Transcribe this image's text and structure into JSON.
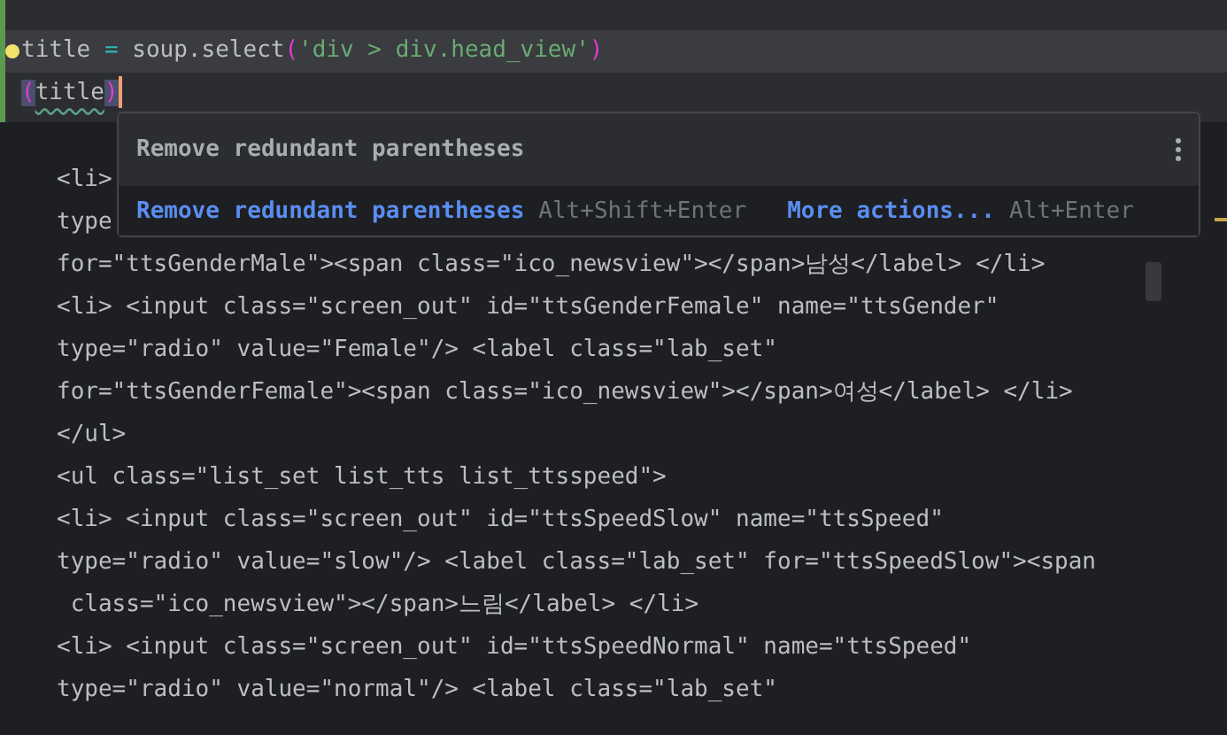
{
  "editor": {
    "block_lines": [
      {
        "highlighted": true,
        "tokens": [
          {
            "kind": "ident",
            "text": "title"
          },
          {
            "kind": "operator",
            "text": " = "
          },
          {
            "kind": "plain",
            "text": "soup.select"
          },
          {
            "kind": "paren",
            "text": "("
          },
          {
            "kind": "string",
            "text": "'div > div.head_view'"
          },
          {
            "kind": "paren",
            "text": ")"
          }
        ]
      },
      {
        "highlighted": false,
        "tokens": [
          {
            "kind": "paren_match",
            "text": "("
          },
          {
            "kind": "warning",
            "text": "title"
          },
          {
            "kind": "paren_match",
            "text": ")"
          }
        ]
      }
    ],
    "lines": [
      "<li>",
      "type",
      "for=\"ttsGenderMale\"><span class=\"ico_newsview\"></span>남성</label> </li>",
      "<li> <input class=\"screen_out\" id=\"ttsGenderFemale\" name=\"ttsGender\"",
      "type=\"radio\" value=\"Female\"/> <label class=\"lab_set\"",
      "for=\"ttsGenderFemale\"><span class=\"ico_newsview\"></span>여성</label> </li>",
      "</ul>",
      "<ul class=\"list_set list_tts list_ttsspeed\">",
      "<li> <input class=\"screen_out\" id=\"ttsSpeedSlow\" name=\"ttsSpeed\"",
      "type=\"radio\" value=\"slow\"/> <label class=\"lab_set\" for=\"ttsSpeedSlow\"><span",
      " class=\"ico_newsview\"></span>느림</label> </li>",
      "<li> <input class=\"screen_out\" id=\"ttsSpeedNormal\" name=\"ttsSpeed\"",
      "type=\"radio\" value=\"normal\"/> <label class=\"lab_set\""
    ]
  },
  "popup": {
    "title": "Remove redundant parentheses",
    "actions": [
      {
        "label": "Remove redundant parentheses",
        "shortcut": "Alt+Shift+Enter"
      },
      {
        "label": "More actions...",
        "shortcut": "Alt+Enter"
      }
    ]
  }
}
